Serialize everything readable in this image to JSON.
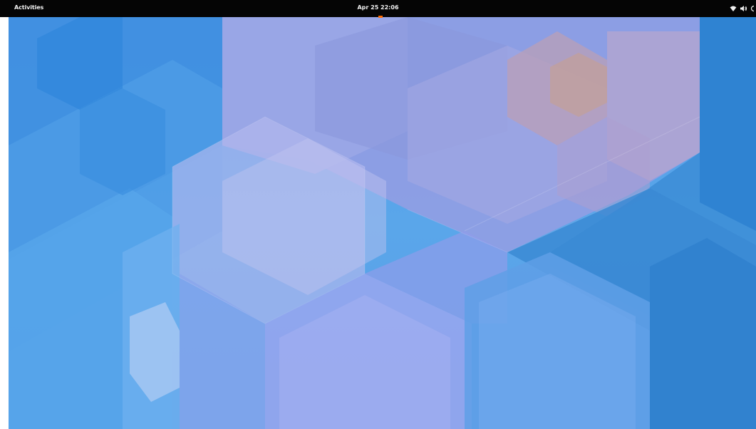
{
  "topbar": {
    "activities_label": "Activities",
    "clock_text": "Apr 25  22:06",
    "status_icons": [
      "wifi-icon",
      "volume-icon",
      "power-icon"
    ],
    "background_color": "#050505",
    "text_color": "#f2f2f2"
  },
  "desktop": {
    "wallpaper_name": "geometric-hexagon-wallpaper",
    "colors": [
      "#4f9be5",
      "#9aa6e6",
      "#b7a6c9",
      "#3e8fd6",
      "#6db0ee"
    ]
  }
}
